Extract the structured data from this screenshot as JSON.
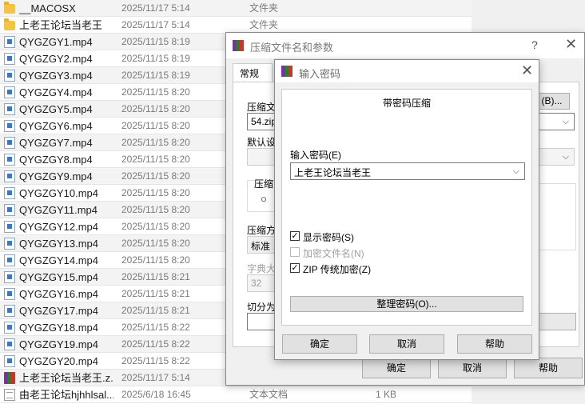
{
  "files": [
    {
      "name": "__MACOSX",
      "date": "2025/11/17 5:14",
      "type": "文件夹",
      "size": "",
      "icon": "folder-icon"
    },
    {
      "name": "上老王论坛当老王",
      "date": "2025/11/17 5:14",
      "type": "文件夹",
      "size": "",
      "icon": "folder-icon"
    },
    {
      "name": "QYGZGY1.mp4",
      "date": "2025/11/15 8:19",
      "type": "",
      "size": "",
      "icon": "video-file-icon"
    },
    {
      "name": "QYGZGY2.mp4",
      "date": "2025/11/15 8:19",
      "type": "",
      "size": "",
      "icon": "video-file-icon"
    },
    {
      "name": "QYGZGY3.mp4",
      "date": "2025/11/15 8:19",
      "type": "",
      "size": "",
      "icon": "video-file-icon"
    },
    {
      "name": "QYGZGY4.mp4",
      "date": "2025/11/15 8:20",
      "type": "",
      "size": "",
      "icon": "video-file-icon"
    },
    {
      "name": "QYGZGY5.mp4",
      "date": "2025/11/15 8:20",
      "type": "",
      "size": "",
      "icon": "video-file-icon"
    },
    {
      "name": "QYGZGY6.mp4",
      "date": "2025/11/15 8:20",
      "type": "",
      "size": "",
      "icon": "video-file-icon"
    },
    {
      "name": "QYGZGY7.mp4",
      "date": "2025/11/15 8:20",
      "type": "",
      "size": "",
      "icon": "video-file-icon"
    },
    {
      "name": "QYGZGY8.mp4",
      "date": "2025/11/15 8:20",
      "type": "",
      "size": "",
      "icon": "video-file-icon"
    },
    {
      "name": "QYGZGY9.mp4",
      "date": "2025/11/15 8:20",
      "type": "",
      "size": "",
      "icon": "video-file-icon"
    },
    {
      "name": "QYGZGY10.mp4",
      "date": "2025/11/15 8:20",
      "type": "",
      "size": "",
      "icon": "video-file-icon"
    },
    {
      "name": "QYGZGY11.mp4",
      "date": "2025/11/15 8:20",
      "type": "",
      "size": "",
      "icon": "video-file-icon"
    },
    {
      "name": "QYGZGY12.mp4",
      "date": "2025/11/15 8:20",
      "type": "",
      "size": "",
      "icon": "video-file-icon"
    },
    {
      "name": "QYGZGY13.mp4",
      "date": "2025/11/15 8:20",
      "type": "",
      "size": "",
      "icon": "video-file-icon"
    },
    {
      "name": "QYGZGY14.mp4",
      "date": "2025/11/15 8:20",
      "type": "",
      "size": "",
      "icon": "video-file-icon"
    },
    {
      "name": "QYGZGY15.mp4",
      "date": "2025/11/15 8:21",
      "type": "",
      "size": "",
      "icon": "video-file-icon"
    },
    {
      "name": "QYGZGY16.mp4",
      "date": "2025/11/15 8:21",
      "type": "",
      "size": "",
      "icon": "video-file-icon"
    },
    {
      "name": "QYGZGY17.mp4",
      "date": "2025/11/15 8:21",
      "type": "",
      "size": "",
      "icon": "video-file-icon"
    },
    {
      "name": "QYGZGY18.mp4",
      "date": "2025/11/15 8:22",
      "type": "",
      "size": "",
      "icon": "video-file-icon"
    },
    {
      "name": "QYGZGY19.mp4",
      "date": "2025/11/15 8:22",
      "type": "",
      "size": "",
      "icon": "video-file-icon"
    },
    {
      "name": "QYGZGY20.mp4",
      "date": "2025/11/15 8:22",
      "type": "",
      "size": "",
      "icon": "video-file-icon"
    },
    {
      "name": "上老王论坛当老王.z...",
      "date": "2025/11/17 5:14",
      "type": "",
      "size": "",
      "icon": "rar-archive-icon"
    },
    {
      "name": "由老王论坛hjhhlsal...",
      "date": "2025/6/18 16:45",
      "type": "文本文档",
      "size": "1 KB",
      "icon": "text-file-icon"
    }
  ],
  "archive_dialog": {
    "title": "压缩文件名和参数",
    "help": "?",
    "close": "✕",
    "tab_general": "常规",
    "archive_name_label": "压缩文",
    "archive_name_value": "54.zip",
    "browse_button": "(B)...",
    "default_settings_label": "默认设",
    "format_label": "压缩",
    "format_radio": "",
    "method_label": "压缩方",
    "method_value": "标准",
    "dict_label": "字典大",
    "dict_value": "32",
    "split_label": "切分为",
    "ok": "确定",
    "cancel": "取消",
    "help_button": "帮助"
  },
  "password_dialog": {
    "title": "输入密码",
    "close": "✕",
    "heading": "带密码压缩",
    "password_label": "输入密码(E)",
    "password_value": "上老王论坛当老王",
    "show_password": "显示密码(S)",
    "encrypt_names": "加密文件名(N)",
    "zip_legacy": "ZIP 传统加密(Z)",
    "organize_button": "整理密码(O)...",
    "ok": "确定",
    "cancel": "取消",
    "help_button": "帮助",
    "show_password_checked": true,
    "encrypt_names_checked": false,
    "zip_legacy_checked": true
  }
}
